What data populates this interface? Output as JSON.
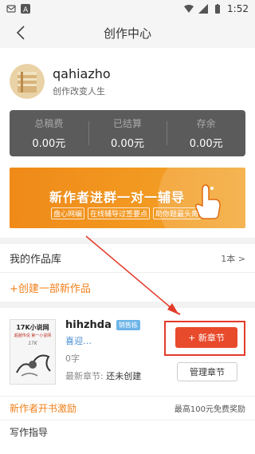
{
  "statusbar": {
    "time": "1:52"
  },
  "navbar": {
    "title": "创作中心"
  },
  "profile": {
    "username": "qahiazho",
    "motto": "创作改变人生"
  },
  "stats": [
    {
      "label": "总稿费",
      "value": "0.00元"
    },
    {
      "label": "已结算",
      "value": "0.00元"
    },
    {
      "label": "存余",
      "value": "0.00元"
    }
  ],
  "banner": {
    "title": "新作者进群一对一辅导",
    "sub": [
      "盘心网编",
      "在线辅导过签要点",
      "助你题最头角"
    ]
  },
  "library": {
    "label": "我的作品库",
    "count": "1本 >"
  },
  "create": {
    "label": "+创建一部新作品"
  },
  "work": {
    "title": "hihzhda",
    "tag": "销售栋",
    "type": "喜迎…",
    "words": "0字",
    "latest_label": "最新章节: ",
    "latest_value": "还未创建",
    "new_chapter_btn": "+ 新章节",
    "manage_btn": "管理章节",
    "cover": {
      "t1": "17K小说网",
      "t2": "超越传说 第一小说网",
      "t3": "17K"
    }
  },
  "incentive": {
    "label": "新作者开书激励",
    "right": "最高100元免费奖励"
  },
  "guide": {
    "label": "写作指导"
  },
  "colors": {
    "accent": "#f0801a",
    "red": "#e84a2c",
    "stats_bg": "#5b5b5b"
  }
}
